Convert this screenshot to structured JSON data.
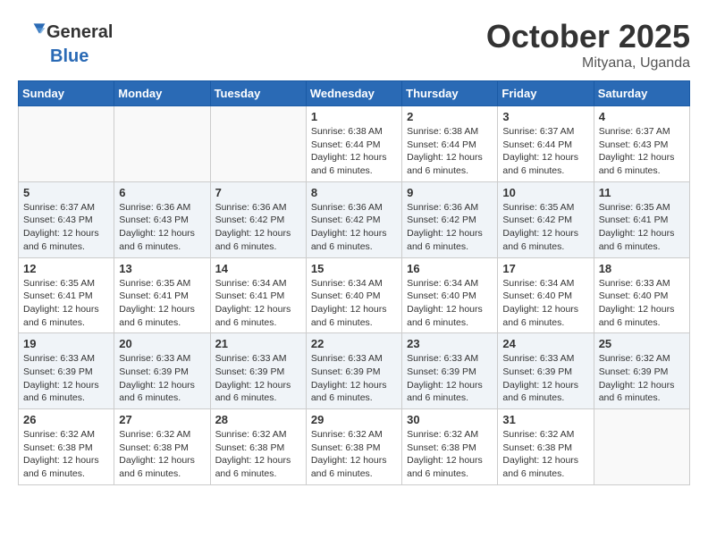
{
  "header": {
    "logo_general": "General",
    "logo_blue": "Blue",
    "month": "October 2025",
    "location": "Mityana, Uganda"
  },
  "weekdays": [
    "Sunday",
    "Monday",
    "Tuesday",
    "Wednesday",
    "Thursday",
    "Friday",
    "Saturday"
  ],
  "weeks": [
    [
      {
        "day": "",
        "sunrise": "",
        "sunset": "",
        "daylight": ""
      },
      {
        "day": "",
        "sunrise": "",
        "sunset": "",
        "daylight": ""
      },
      {
        "day": "",
        "sunrise": "",
        "sunset": "",
        "daylight": ""
      },
      {
        "day": "1",
        "sunrise": "Sunrise: 6:38 AM",
        "sunset": "Sunset: 6:44 PM",
        "daylight": "Daylight: 12 hours and 6 minutes."
      },
      {
        "day": "2",
        "sunrise": "Sunrise: 6:38 AM",
        "sunset": "Sunset: 6:44 PM",
        "daylight": "Daylight: 12 hours and 6 minutes."
      },
      {
        "day": "3",
        "sunrise": "Sunrise: 6:37 AM",
        "sunset": "Sunset: 6:44 PM",
        "daylight": "Daylight: 12 hours and 6 minutes."
      },
      {
        "day": "4",
        "sunrise": "Sunrise: 6:37 AM",
        "sunset": "Sunset: 6:43 PM",
        "daylight": "Daylight: 12 hours and 6 minutes."
      }
    ],
    [
      {
        "day": "5",
        "sunrise": "Sunrise: 6:37 AM",
        "sunset": "Sunset: 6:43 PM",
        "daylight": "Daylight: 12 hours and 6 minutes."
      },
      {
        "day": "6",
        "sunrise": "Sunrise: 6:36 AM",
        "sunset": "Sunset: 6:43 PM",
        "daylight": "Daylight: 12 hours and 6 minutes."
      },
      {
        "day": "7",
        "sunrise": "Sunrise: 6:36 AM",
        "sunset": "Sunset: 6:42 PM",
        "daylight": "Daylight: 12 hours and 6 minutes."
      },
      {
        "day": "8",
        "sunrise": "Sunrise: 6:36 AM",
        "sunset": "Sunset: 6:42 PM",
        "daylight": "Daylight: 12 hours and 6 minutes."
      },
      {
        "day": "9",
        "sunrise": "Sunrise: 6:36 AM",
        "sunset": "Sunset: 6:42 PM",
        "daylight": "Daylight: 12 hours and 6 minutes."
      },
      {
        "day": "10",
        "sunrise": "Sunrise: 6:35 AM",
        "sunset": "Sunset: 6:42 PM",
        "daylight": "Daylight: 12 hours and 6 minutes."
      },
      {
        "day": "11",
        "sunrise": "Sunrise: 6:35 AM",
        "sunset": "Sunset: 6:41 PM",
        "daylight": "Daylight: 12 hours and 6 minutes."
      }
    ],
    [
      {
        "day": "12",
        "sunrise": "Sunrise: 6:35 AM",
        "sunset": "Sunset: 6:41 PM",
        "daylight": "Daylight: 12 hours and 6 minutes."
      },
      {
        "day": "13",
        "sunrise": "Sunrise: 6:35 AM",
        "sunset": "Sunset: 6:41 PM",
        "daylight": "Daylight: 12 hours and 6 minutes."
      },
      {
        "day": "14",
        "sunrise": "Sunrise: 6:34 AM",
        "sunset": "Sunset: 6:41 PM",
        "daylight": "Daylight: 12 hours and 6 minutes."
      },
      {
        "day": "15",
        "sunrise": "Sunrise: 6:34 AM",
        "sunset": "Sunset: 6:40 PM",
        "daylight": "Daylight: 12 hours and 6 minutes."
      },
      {
        "day": "16",
        "sunrise": "Sunrise: 6:34 AM",
        "sunset": "Sunset: 6:40 PM",
        "daylight": "Daylight: 12 hours and 6 minutes."
      },
      {
        "day": "17",
        "sunrise": "Sunrise: 6:34 AM",
        "sunset": "Sunset: 6:40 PM",
        "daylight": "Daylight: 12 hours and 6 minutes."
      },
      {
        "day": "18",
        "sunrise": "Sunrise: 6:33 AM",
        "sunset": "Sunset: 6:40 PM",
        "daylight": "Daylight: 12 hours and 6 minutes."
      }
    ],
    [
      {
        "day": "19",
        "sunrise": "Sunrise: 6:33 AM",
        "sunset": "Sunset: 6:39 PM",
        "daylight": "Daylight: 12 hours and 6 minutes."
      },
      {
        "day": "20",
        "sunrise": "Sunrise: 6:33 AM",
        "sunset": "Sunset: 6:39 PM",
        "daylight": "Daylight: 12 hours and 6 minutes."
      },
      {
        "day": "21",
        "sunrise": "Sunrise: 6:33 AM",
        "sunset": "Sunset: 6:39 PM",
        "daylight": "Daylight: 12 hours and 6 minutes."
      },
      {
        "day": "22",
        "sunrise": "Sunrise: 6:33 AM",
        "sunset": "Sunset: 6:39 PM",
        "daylight": "Daylight: 12 hours and 6 minutes."
      },
      {
        "day": "23",
        "sunrise": "Sunrise: 6:33 AM",
        "sunset": "Sunset: 6:39 PM",
        "daylight": "Daylight: 12 hours and 6 minutes."
      },
      {
        "day": "24",
        "sunrise": "Sunrise: 6:33 AM",
        "sunset": "Sunset: 6:39 PM",
        "daylight": "Daylight: 12 hours and 6 minutes."
      },
      {
        "day": "25",
        "sunrise": "Sunrise: 6:32 AM",
        "sunset": "Sunset: 6:39 PM",
        "daylight": "Daylight: 12 hours and 6 minutes."
      }
    ],
    [
      {
        "day": "26",
        "sunrise": "Sunrise: 6:32 AM",
        "sunset": "Sunset: 6:38 PM",
        "daylight": "Daylight: 12 hours and 6 minutes."
      },
      {
        "day": "27",
        "sunrise": "Sunrise: 6:32 AM",
        "sunset": "Sunset: 6:38 PM",
        "daylight": "Daylight: 12 hours and 6 minutes."
      },
      {
        "day": "28",
        "sunrise": "Sunrise: 6:32 AM",
        "sunset": "Sunset: 6:38 PM",
        "daylight": "Daylight: 12 hours and 6 minutes."
      },
      {
        "day": "29",
        "sunrise": "Sunrise: 6:32 AM",
        "sunset": "Sunset: 6:38 PM",
        "daylight": "Daylight: 12 hours and 6 minutes."
      },
      {
        "day": "30",
        "sunrise": "Sunrise: 6:32 AM",
        "sunset": "Sunset: 6:38 PM",
        "daylight": "Daylight: 12 hours and 6 minutes."
      },
      {
        "day": "31",
        "sunrise": "Sunrise: 6:32 AM",
        "sunset": "Sunset: 6:38 PM",
        "daylight": "Daylight: 12 hours and 6 minutes."
      },
      {
        "day": "",
        "sunrise": "",
        "sunset": "",
        "daylight": ""
      }
    ]
  ]
}
